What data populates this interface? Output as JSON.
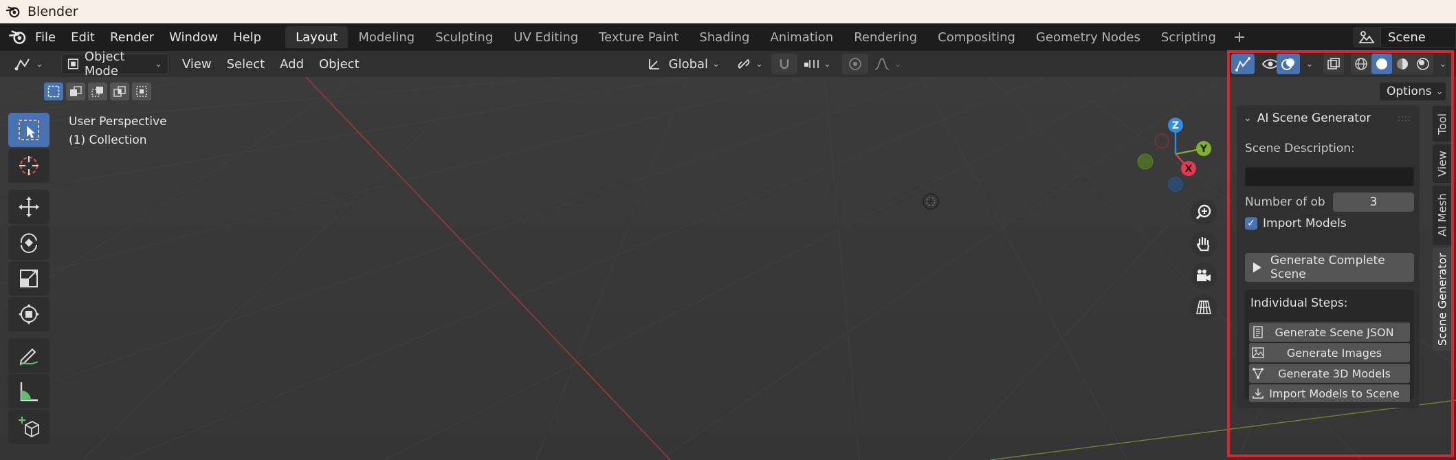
{
  "window": {
    "title": "Blender"
  },
  "menu": {
    "items": [
      "File",
      "Edit",
      "Render",
      "Window",
      "Help"
    ]
  },
  "workspaces": {
    "tabs": [
      "Layout",
      "Modeling",
      "Sculpting",
      "UV Editing",
      "Texture Paint",
      "Shading",
      "Animation",
      "Rendering",
      "Compositing",
      "Geometry Nodes",
      "Scripting"
    ],
    "active": "Layout",
    "add": "+"
  },
  "scene": {
    "name": "Scene"
  },
  "header": {
    "mode": "Object Mode",
    "menus": [
      "View",
      "Select",
      "Add",
      "Object"
    ],
    "transform_orientation": "Global"
  },
  "viewport": {
    "perspective": "User Perspective",
    "collection": "(1) Collection",
    "axes": {
      "x": "X",
      "y": "Y",
      "z": "Z"
    }
  },
  "sidebar": {
    "options_label": "Options",
    "panel_title": "AI Scene Generator",
    "scene_description_label": "Scene Description:",
    "scene_description_value": "",
    "number_label": "Number of ob",
    "number_value": "3",
    "import_models_label": "Import Models",
    "import_models_checked": true,
    "generate_complete_label": "Generate Complete Scene",
    "individual_steps_label": "Individual Steps:",
    "steps": [
      "Generate Scene JSON",
      "Generate Images",
      "Generate 3D Models",
      "Import Models to Scene"
    ],
    "tabs": [
      "Tool",
      "View",
      "AI Mesh",
      "Scene Generator"
    ],
    "active_tab": "Scene Generator"
  },
  "colors": {
    "accent": "#4772b3",
    "highlight_frame": "#e0222a",
    "axis_x": "#e8384f",
    "axis_y": "#7fb32b",
    "axis_z": "#2c8ee6"
  }
}
